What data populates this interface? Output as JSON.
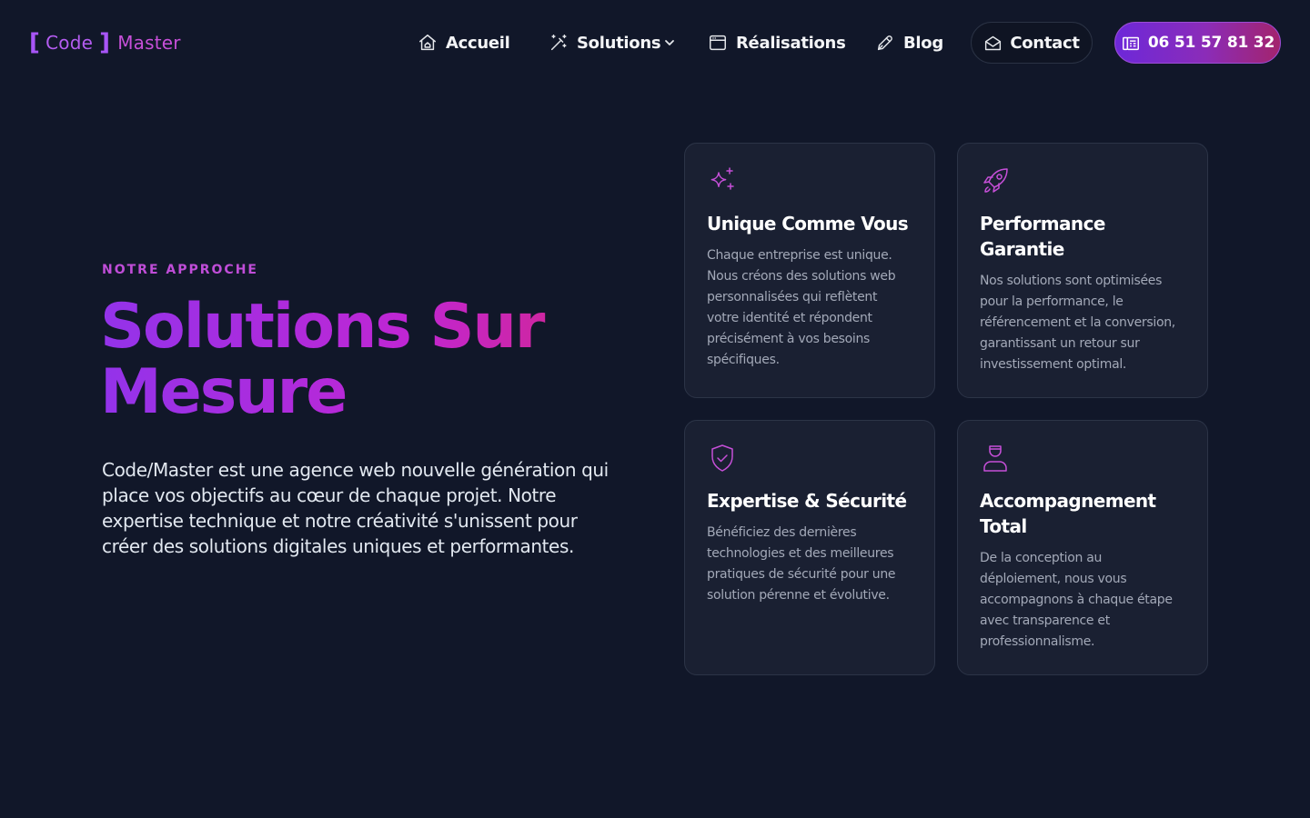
{
  "logo": {
    "open_bracket": "[",
    "code": "Code",
    "close_bracket": "]",
    "master": "Master"
  },
  "nav": {
    "items": [
      {
        "label": "Accueil",
        "icon": "home-icon"
      },
      {
        "label": "Solutions",
        "icon": "magic-wand-icon",
        "has_dropdown": true
      },
      {
        "label": "Réalisations",
        "icon": "browser-window-icon"
      },
      {
        "label": "Blog",
        "icon": "pen-nib-icon"
      }
    ],
    "contact_label": "Contact",
    "contact_icon": "envelope-open-icon",
    "phone_label": "06 51 57 81 32",
    "phone_icon": "fax-phone-icon"
  },
  "hero": {
    "eyebrow": "NOTRE APPROCHE",
    "headline": "Solutions Sur Mesure",
    "intro": "Code/Master est une agence web nouvelle génération qui place vos objectifs au cœur de chaque projet. Notre expertise technique et notre créativité s'unissent pour créer des solutions digitales uniques et performantes."
  },
  "cards": [
    {
      "icon": "sparkles-icon",
      "title": "Unique Comme Vous",
      "text": "Chaque entreprise est unique. Nous créons des solutions web personnalisées qui reflètent votre identité et répondent précisément à vos besoins spécifiques."
    },
    {
      "icon": "rocket-icon",
      "title": "Performance Garantie",
      "text": "Nos solutions sont optimisées pour la performance, le référencement et la conversion, garantissant un retour sur investissement optimal."
    },
    {
      "icon": "shield-check-icon",
      "title": "Expertise & Sécurité",
      "text": "Bénéficiez des dernières technologies et des meilleures pratiques de sécurité pour une solution pérenne et évolutive."
    },
    {
      "icon": "user-support-icon",
      "title": "Accompagnement Total",
      "text": "De la conception au déploiement, nous vous accompagnons à chaque étape avec transparence et professionnalisme."
    }
  ],
  "colors": {
    "background": "#111729",
    "card_background": "#1a2032",
    "accent_purple": "#9333ea",
    "accent_pink": "#db2777",
    "eyebrow": "#c04dd8"
  }
}
